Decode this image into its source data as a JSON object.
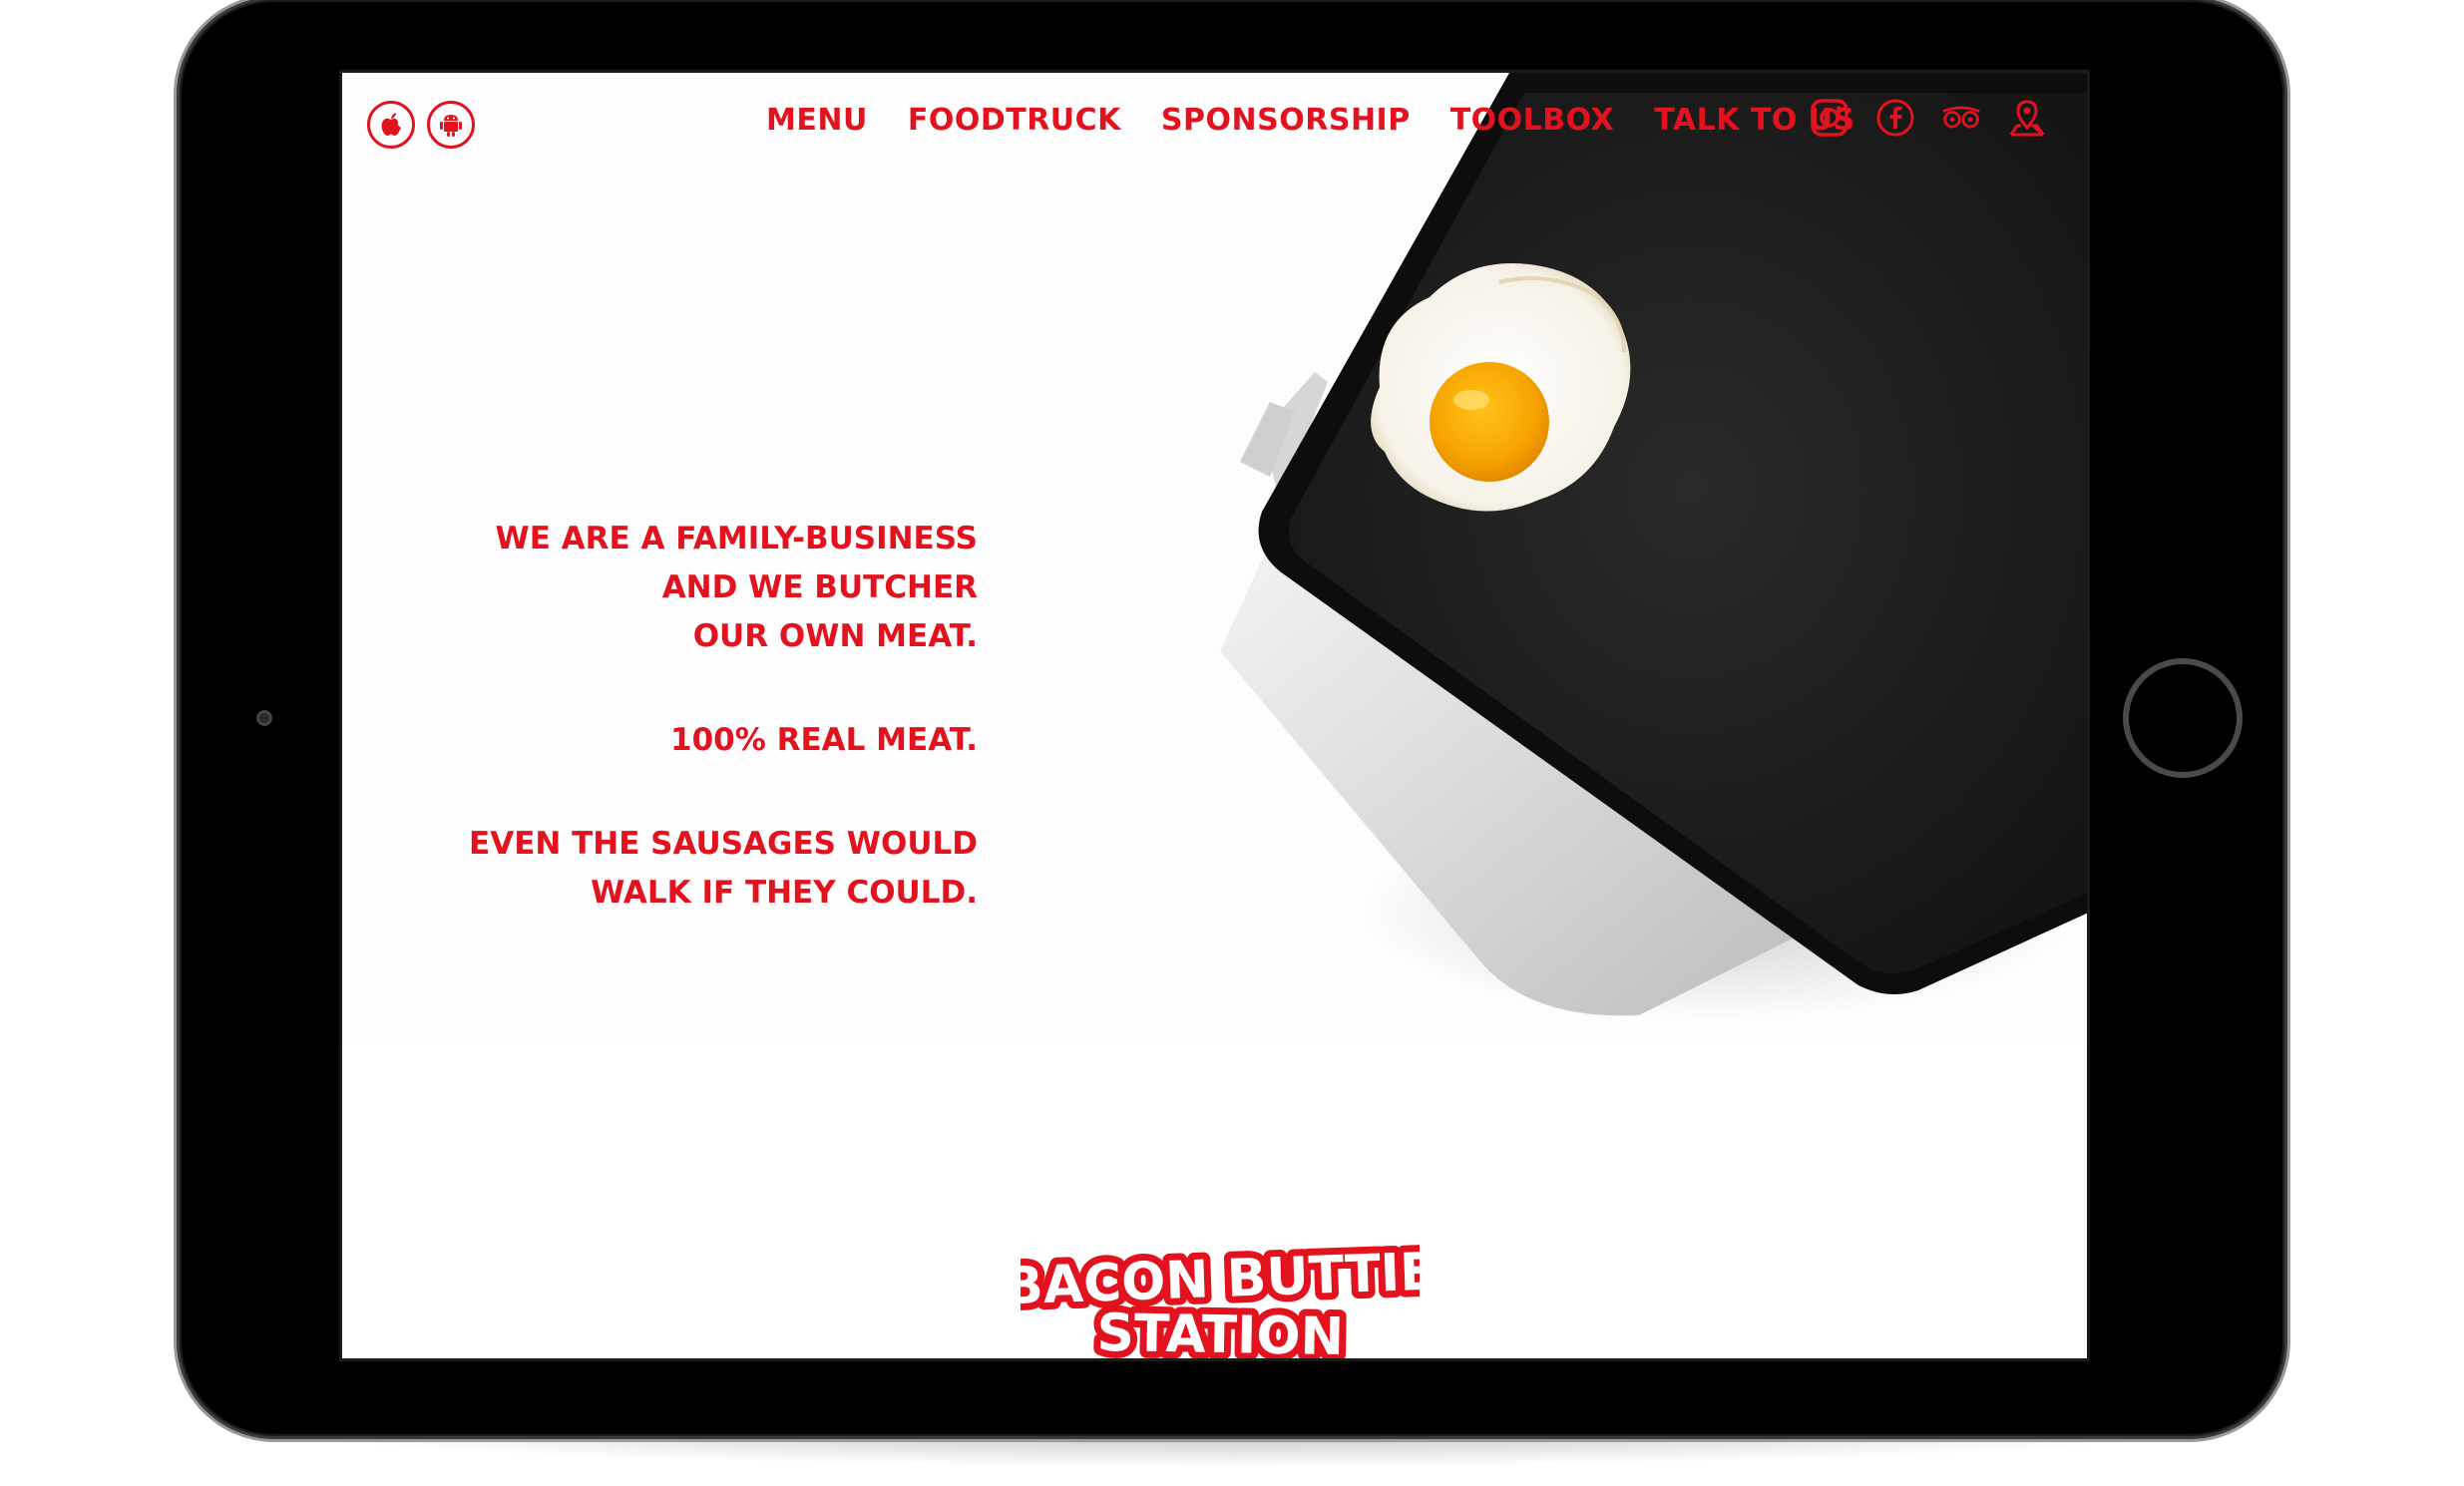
{
  "nav": {
    "app_icons": [
      {
        "icon": "apple-icon"
      },
      {
        "icon": "android-icon"
      }
    ],
    "links": [
      {
        "label": "MENU"
      },
      {
        "label": "FOODTRUCK"
      },
      {
        "label": "SPONSORSHIP"
      },
      {
        "label": "TOOLBOX"
      },
      {
        "label": "TALK TO US"
      }
    ],
    "social": [
      {
        "icon": "instagram-icon"
      },
      {
        "icon": "facebook-icon"
      },
      {
        "icon": "tripadvisor-icon"
      },
      {
        "icon": "map-pin-icon"
      }
    ]
  },
  "tagline": {
    "block1": [
      "WE ARE A FAMILY-BUSINESS",
      "AND WE BUTCHER",
      "OUR OWN MEAT."
    ],
    "block2": [
      "100% REAL MEAT."
    ],
    "block3": [
      "EVEN THE SAUSAGES WOULD",
      "WALK IF THEY COULD."
    ]
  },
  "logo": {
    "line1": "BACON BUTTIE",
    "line2": "STATION"
  },
  "colors": {
    "brand_red": "#e2121f",
    "background": "#ffffff",
    "griddle": "#1e1e1e"
  }
}
